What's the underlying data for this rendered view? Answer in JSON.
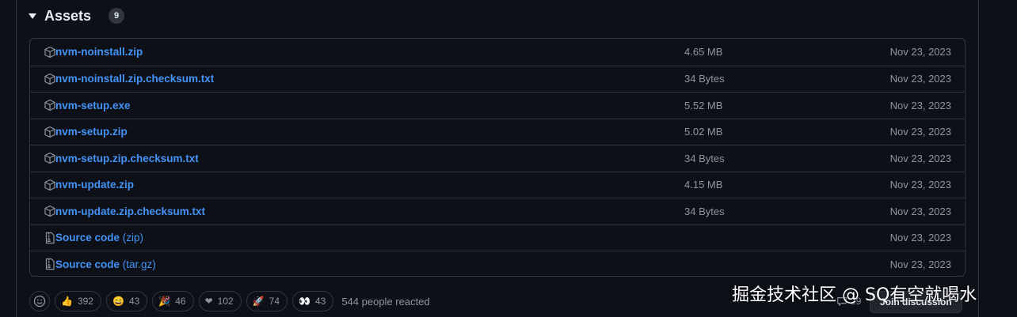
{
  "assets": {
    "title": "Assets",
    "count": "9",
    "items": [
      {
        "name": "nvm-noinstall.zip",
        "ext": "",
        "size": "4.65 MB",
        "date": "Nov 23, 2023",
        "icon": "package-icon"
      },
      {
        "name": "nvm-noinstall.zip.checksum.txt",
        "ext": "",
        "size": "34 Bytes",
        "date": "Nov 23, 2023",
        "icon": "package-icon"
      },
      {
        "name": "nvm-setup.exe",
        "ext": "",
        "size": "5.52 MB",
        "date": "Nov 23, 2023",
        "icon": "package-icon"
      },
      {
        "name": "nvm-setup.zip",
        "ext": "",
        "size": "5.02 MB",
        "date": "Nov 23, 2023",
        "icon": "package-icon"
      },
      {
        "name": "nvm-setup.zip.checksum.txt",
        "ext": "",
        "size": "34 Bytes",
        "date": "Nov 23, 2023",
        "icon": "package-icon"
      },
      {
        "name": "nvm-update.zip",
        "ext": "",
        "size": "4.15 MB",
        "date": "Nov 23, 2023",
        "icon": "package-icon"
      },
      {
        "name": "nvm-update.zip.checksum.txt",
        "ext": "",
        "size": "34 Bytes",
        "date": "Nov 23, 2023",
        "icon": "package-icon"
      },
      {
        "name": "Source code",
        "ext": "(zip)",
        "size": "",
        "date": "Nov 23, 2023",
        "icon": "file-zip-icon"
      },
      {
        "name": "Source code",
        "ext": "(tar.gz)",
        "size": "",
        "date": "Nov 23, 2023",
        "icon": "file-zip-icon"
      }
    ]
  },
  "reactions": {
    "items": [
      {
        "emoji": "👍",
        "count": "392",
        "icon": "thumbs-up-icon"
      },
      {
        "emoji": "😄",
        "count": "43",
        "icon": "smile-icon"
      },
      {
        "emoji": "🎉",
        "count": "46",
        "icon": "tada-icon"
      },
      {
        "emoji": "❤",
        "count": "102",
        "icon": "heart-icon"
      },
      {
        "emoji": "🚀",
        "count": "74",
        "icon": "rocket-icon"
      },
      {
        "emoji": "👀",
        "count": "43",
        "icon": "eyes-icon"
      }
    ],
    "summary": "544 people reacted"
  },
  "discussion": {
    "count": "29",
    "join_label": "Join discussion"
  },
  "watermark": "掘金技术社区 @ SQ有空就喝水",
  "colors": {
    "background": "#0d1117",
    "border": "#30363d",
    "link": "#4493f8",
    "muted": "#8d96a0"
  }
}
